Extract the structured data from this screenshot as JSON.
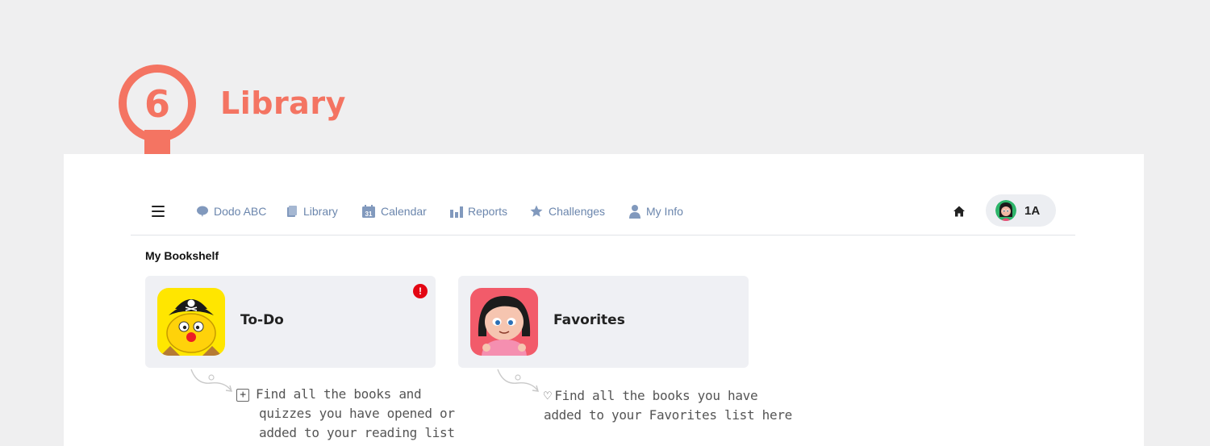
{
  "step": {
    "number": "6",
    "title": "Library",
    "color": "#f47462"
  },
  "nav": {
    "items": [
      {
        "label": "Dodo ABC",
        "icon": "speech-bubble-icon"
      },
      {
        "label": "Library",
        "icon": "book-icon"
      },
      {
        "label": "Calendar",
        "icon": "calendar-icon",
        "icon_text": "31"
      },
      {
        "label": "Reports",
        "icon": "bar-chart-icon"
      },
      {
        "label": "Challenges",
        "icon": "star-icon"
      },
      {
        "label": "My Info",
        "icon": "person-icon"
      }
    ],
    "user": {
      "name": "1A"
    }
  },
  "bookshelf": {
    "title": "My Bookshelf",
    "cards": [
      {
        "label": "To-Do",
        "alert": "!"
      },
      {
        "label": "Favorites"
      }
    ]
  },
  "notes": {
    "todo": {
      "icon_text": "+",
      "lines": [
        "Find all the books and",
        "quizzes you have opened or",
        "added to your reading list"
      ]
    },
    "favorites": {
      "icon_text": "♡",
      "lines": [
        "Find all the books you have",
        "added to your Favorites list here"
      ]
    }
  },
  "colors": {
    "nav_text": "#6b86ad",
    "accent": "#f47462",
    "alert": "#e30613"
  }
}
